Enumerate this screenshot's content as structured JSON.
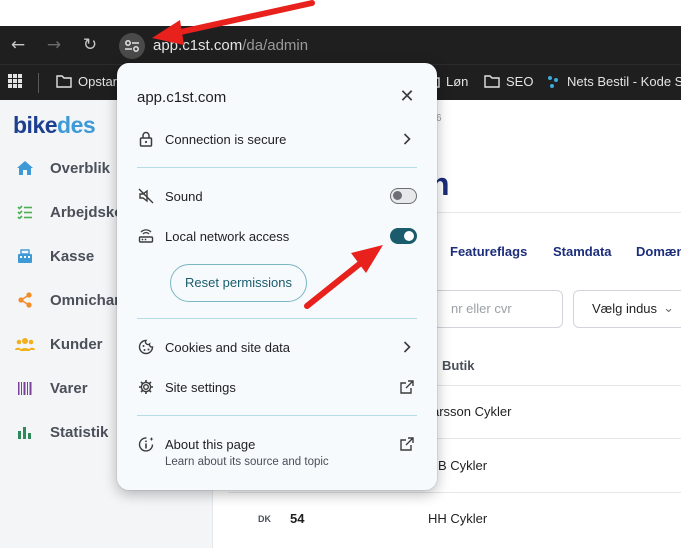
{
  "browser": {
    "url_host": "app.c1st.com",
    "url_path": "/da/admin",
    "bookmarks": [
      {
        "label": "Opstar",
        "icon": "folder-icon"
      },
      {
        "label": "Løn",
        "icon": "folder-icon"
      },
      {
        "label": "SEO",
        "icon": "folder-icon"
      },
      {
        "label": "Nets Bestil - Kode S...",
        "icon": "nets-icon"
      }
    ]
  },
  "sidebar": {
    "brand_part1": "bike",
    "brand_part2": "des",
    "items": [
      {
        "label": "Overblik",
        "icon": "home-icon",
        "color": "#3d9ad6"
      },
      {
        "label": "Arbejdsko",
        "icon": "checklist-icon",
        "color": "#4caf50"
      },
      {
        "label": "Kasse",
        "icon": "register-icon",
        "color": "#3d9ad6"
      },
      {
        "label": "Omnichar",
        "icon": "share-icon",
        "color": "#f28c28"
      },
      {
        "label": "Kunder",
        "icon": "people-icon",
        "color": "#f2b01e"
      },
      {
        "label": "Varer",
        "icon": "barcode-icon",
        "color": "#7b3fa0"
      },
      {
        "label": "Statistik",
        "icon": "bar-chart-icon",
        "color": "#2e8b57"
      }
    ]
  },
  "main": {
    "crumb_fragment": "6",
    "title_fragment": "n",
    "tabs": [
      "Featureflags",
      "Stamdata",
      "Domæn"
    ],
    "search_placeholder": "nr eller cvr",
    "industry_select": "Vælg indus",
    "column_header": "Butik",
    "rows": [
      {
        "country": "",
        "id": "",
        "shop": "arsson Cykler"
      },
      {
        "country": "",
        "id": "",
        "shop": "B Cykler"
      },
      {
        "country": "DK",
        "id": "54",
        "shop": "HH Cykler"
      }
    ]
  },
  "popup": {
    "title": "app.c1st.com",
    "connection_label": "Connection is secure",
    "sound_label": "Sound",
    "sound_enabled": false,
    "local_network_label": "Local network access",
    "local_network_enabled": true,
    "reset_label": "Reset permissions",
    "cookies_label": "Cookies and site data",
    "site_settings_label": "Site settings",
    "about_label": "About this page",
    "about_sub": "Learn about its source and topic"
  },
  "colors": {
    "accent": "#1a5c6b",
    "annotation_arrow": "#e8211d"
  }
}
